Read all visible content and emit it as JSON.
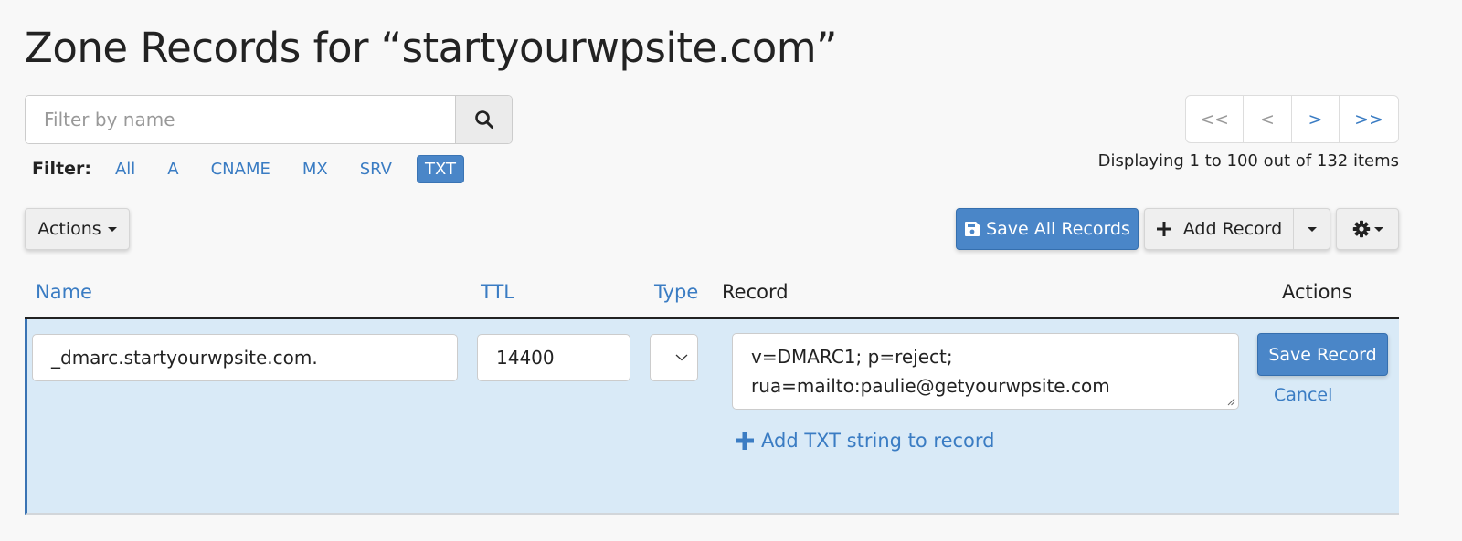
{
  "page": {
    "title": "Zone Records for “startyourwpsite.com”"
  },
  "search": {
    "placeholder": "Filter by name",
    "value": "",
    "button_icon": "search-icon"
  },
  "filter": {
    "label": "Filter:",
    "options": [
      {
        "label": "All",
        "active": false
      },
      {
        "label": "A",
        "active": false
      },
      {
        "label": "CNAME",
        "active": false
      },
      {
        "label": "MX",
        "active": false
      },
      {
        "label": "SRV",
        "active": false
      },
      {
        "label": "TXT",
        "active": true
      }
    ]
  },
  "pagination": {
    "first": "<<",
    "prev": "<",
    "next": ">",
    "last": ">>",
    "status": "Displaying 1 to 100 out of 132 items"
  },
  "toolbar": {
    "actions_label": "Actions",
    "save_all_label": "Save All Records",
    "save_all_icon": "floppy-disk-icon",
    "add_record_label": "Add Record",
    "add_record_icon": "plus-icon",
    "settings_icon": "gear-icon"
  },
  "table": {
    "headers": {
      "name": "Name",
      "ttl": "TTL",
      "type": "Type",
      "record": "Record",
      "actions": "Actions"
    },
    "edit_row": {
      "name": "_dmarc.startyourwpsite.com.",
      "ttl": "14400",
      "type": "",
      "record_lines": [
        "v=DMARC1; p=reject;",
        "rua=mailto:paulie@getyourwpsite.com"
      ],
      "save_label": "Save Record",
      "cancel_label": "Cancel",
      "add_txt_label": "Add TXT string to record"
    }
  },
  "colors": {
    "accent": "#4a86c8",
    "link": "#3a7cc3",
    "edit_row_bg": "#d9eaf7",
    "page_bg": "#f8f8f8"
  }
}
